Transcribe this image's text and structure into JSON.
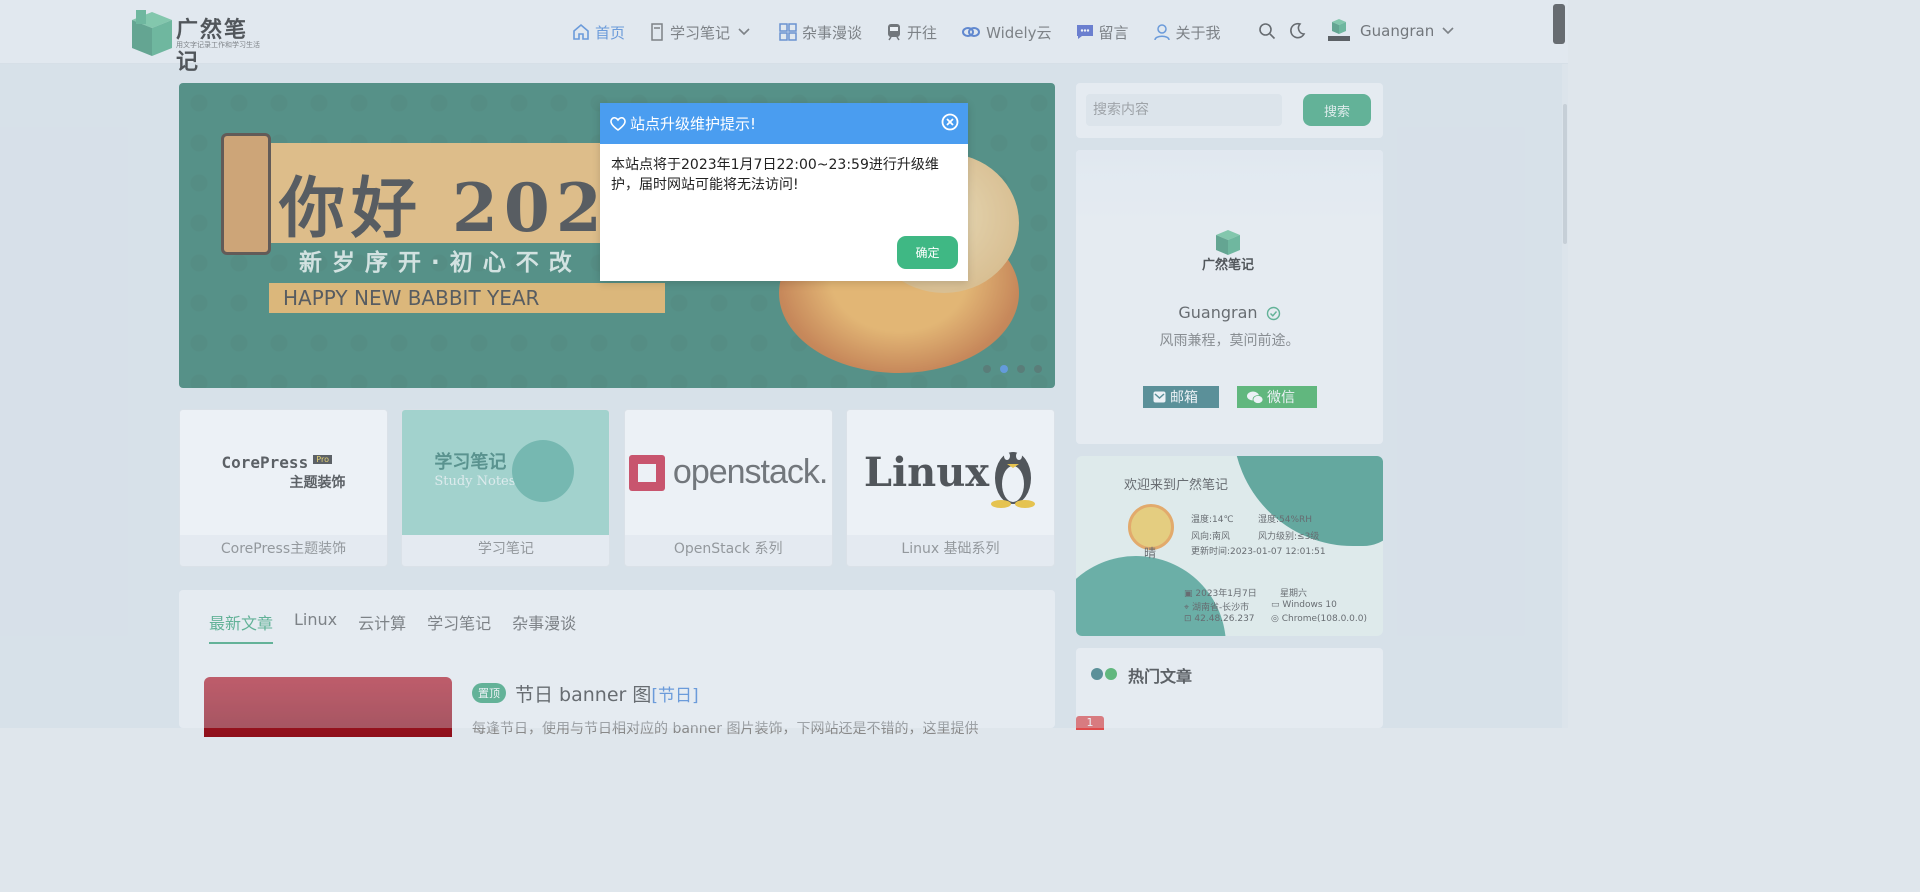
{
  "header": {
    "logo_title": "广然笔记",
    "logo_subtitle": "用文字记录工作和学习生活",
    "nav": [
      {
        "label": "首页",
        "icon": "home-icon",
        "active": true
      },
      {
        "label": "学习笔记",
        "icon": "notes-icon",
        "dropdown": true
      },
      {
        "label": "杂事漫谈",
        "icon": "grid-icon"
      },
      {
        "label": "开往",
        "icon": "train-icon"
      },
      {
        "label": "Widely云",
        "icon": "cloud-link-icon"
      },
      {
        "label": "留言",
        "icon": "message-icon"
      },
      {
        "label": "关于我",
        "icon": "user-icon"
      }
    ],
    "user_name": "Guangran",
    "user_avatar_text": "广然笔记"
  },
  "banner": {
    "title": "你好 2023",
    "subtitle": "新岁序开·初心不改",
    "english": "HAPPY NEW BABBIT YEAR",
    "active_dot": 1,
    "dot_count": 4
  },
  "categories": [
    {
      "label": "CorePress主题装饰",
      "logo": "CorePress",
      "logo_sub": "主题装饰",
      "badge": "Pro"
    },
    {
      "label": "学习笔记",
      "logo": "学习笔记",
      "logo_sub": "Study Notes"
    },
    {
      "label": "OpenStack 系列",
      "logo": "openstack."
    },
    {
      "label": "Linux 基础系列",
      "logo": "Linux"
    }
  ],
  "tabs": [
    "最新文章",
    "Linux",
    "云计算",
    "学习笔记",
    "杂事漫谈"
  ],
  "post": {
    "pin_label": "置顶",
    "title": "节日 banner 图",
    "category": "[节日]",
    "excerpt": "每逢节日，使用与节日相对应的 banner 图片装饰，下网站还是不错的，这里提供"
  },
  "sidebar": {
    "search_placeholder": "搜索内容",
    "search_button": "搜索",
    "profile_logo": "广然笔记",
    "profile_name": "Guangran",
    "profile_motto": "风雨兼程，莫问前途。",
    "email_label": "邮箱",
    "wechat_label": "微信",
    "weather": {
      "title": "欢迎来到广然笔记",
      "condition": "晴",
      "temp": "温度:14℃",
      "humidity": "湿度:54%RH",
      "wind_dir": "风向:南风",
      "wind_level": "风力级别:≤3级",
      "updated": "更新时间:2023-01-07 12:01:51",
      "date": "2023年1月7日",
      "weekday": "星期六",
      "location": "湖南省-长沙市",
      "os": "Windows 10",
      "ip": "42.48.26.237",
      "browser": "Chrome(108.0.0.0)"
    },
    "hot_title": "热门文章",
    "hot_rank_first": "1"
  },
  "modal": {
    "title": "站点升级维护提示!",
    "body": "本站点将于2023年1月7日22:00~23:59进行升级维护，届时网站可能将无法访问!",
    "ok_label": "确定"
  },
  "colors": {
    "brand_green": "#2d9f6f",
    "modal_header": "#4a9df0",
    "nav_active": "#3a7bd5"
  }
}
